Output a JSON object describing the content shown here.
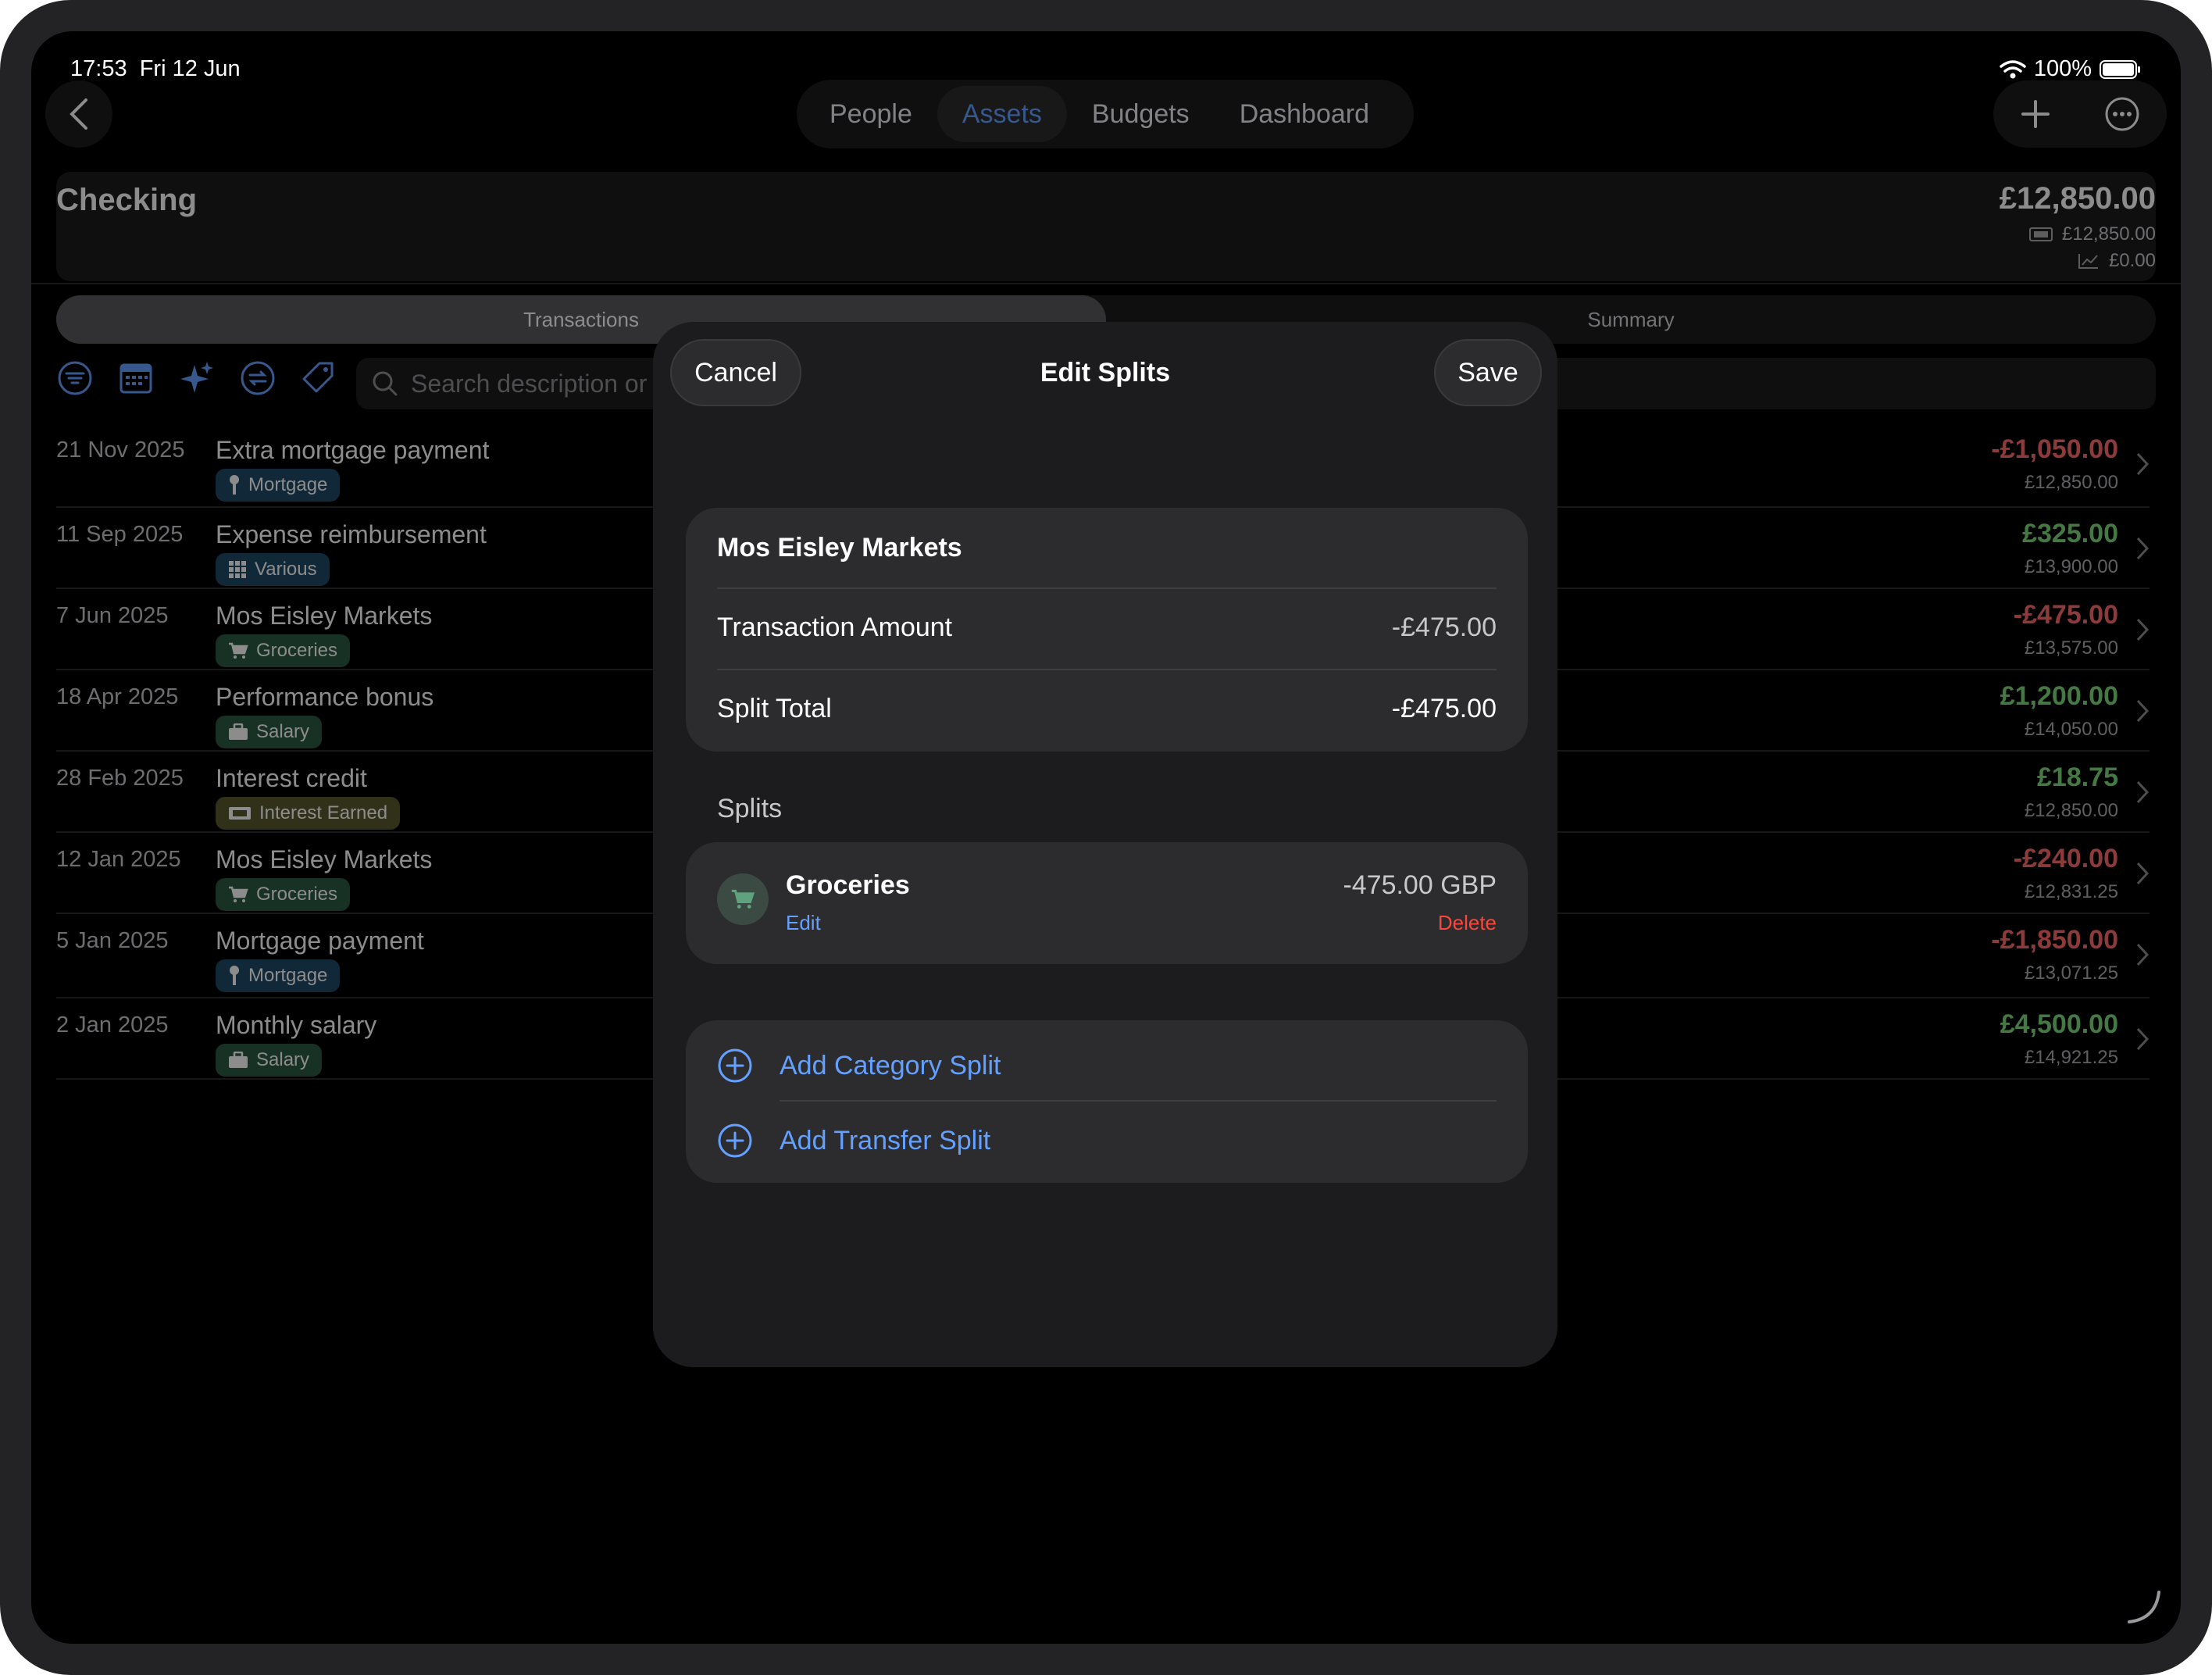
{
  "status": {
    "time": "17:53",
    "date": "Fri 12 Jun",
    "battery": "100%"
  },
  "nav": {
    "tabs": [
      {
        "label": "People"
      },
      {
        "label": "Assets"
      },
      {
        "label": "Budgets"
      },
      {
        "label": "Dashboard"
      }
    ],
    "active_tab": "Assets"
  },
  "account": {
    "name": "Checking",
    "balance": "£12,850.00",
    "cleared": "£12,850.00",
    "investment": "£0.00"
  },
  "view_tabs": {
    "transactions": "Transactions",
    "summary": "Summary"
  },
  "search": {
    "placeholder": "Search description or"
  },
  "transactions": [
    {
      "date": "21 Nov 2025",
      "title": "Extra mortgage payment",
      "tag": "Mortgage",
      "amount": "-£1,050.00",
      "running": "£12,850.00"
    },
    {
      "date": "11 Sep 2025",
      "title": "Expense reimbursement",
      "tag": "Various",
      "amount": "£325.00",
      "running": "£13,900.00"
    },
    {
      "date": "7 Jun 2025",
      "title": "Mos Eisley Markets",
      "tag": "Groceries",
      "amount": "-£475.00",
      "running": "£13,575.00"
    },
    {
      "date": "18 Apr 2025",
      "title": "Performance bonus",
      "tag": "Salary",
      "amount": "£1,200.00",
      "running": "£14,050.00"
    },
    {
      "date": "28 Feb 2025",
      "title": "Interest credit",
      "tag": "Interest Earned",
      "amount": "£18.75",
      "running": "£12,850.00"
    },
    {
      "date": "12 Jan 2025",
      "title": "Mos Eisley Markets",
      "tag": "Groceries",
      "amount": "-£240.00",
      "running": "£12,831.25"
    },
    {
      "date": "5 Jan 2025",
      "title": "Mortgage payment",
      "tag": "Mortgage",
      "amount": "-£1,850.00",
      "running": "£13,071.25"
    },
    {
      "date": "2 Jan 2025",
      "title": "Monthly salary",
      "tag": "Salary",
      "amount": "£4,500.00",
      "running": "£14,921.25"
    }
  ],
  "modal": {
    "cancel": "Cancel",
    "title": "Edit Splits",
    "save": "Save",
    "payee": "Mos Eisley Markets",
    "transaction_amount_label": "Transaction Amount",
    "transaction_amount": "-£475.00",
    "split_total_label": "Split Total",
    "split_total": "-£475.00",
    "splits_label": "Splits",
    "split": {
      "category": "Groceries",
      "edit": "Edit",
      "amount": "-475.00 GBP",
      "delete": "Delete"
    },
    "add_category": "Add Category Split",
    "add_transfer": "Add Transfer Split"
  },
  "colors": {
    "accent": "#64a0ff",
    "negative": "#ff6b6b",
    "positive": "#7ddc7d",
    "destructive": "#ff453a"
  }
}
